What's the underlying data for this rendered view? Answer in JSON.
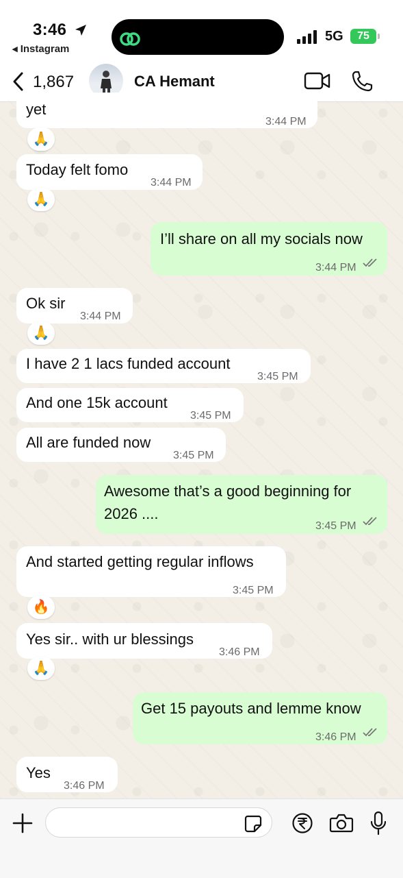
{
  "status_bar": {
    "time": "3:46",
    "back_app": "◂ Instagram",
    "network": "5G",
    "battery": "75"
  },
  "header": {
    "back_count": "1,867",
    "contact_name": "CA Hemant"
  },
  "messages": [
    {
      "dir": "in",
      "text": "yet",
      "time": "3:44 PM",
      "reaction": "🙏"
    },
    {
      "dir": "in",
      "text": "Today felt fomo",
      "time": "3:44 PM",
      "reaction": "🙏"
    },
    {
      "dir": "out",
      "text": "I’ll share on all my socials now",
      "time": "3:44 PM"
    },
    {
      "dir": "in",
      "text": "Ok sir",
      "time": "3:44 PM",
      "reaction": "🙏"
    },
    {
      "dir": "in",
      "text": "I have 2 1 lacs funded account",
      "time": "3:45 PM"
    },
    {
      "dir": "in",
      "text": "And one 15k account",
      "time": "3:45 PM"
    },
    {
      "dir": "in",
      "text": "All are funded now",
      "time": "3:45 PM"
    },
    {
      "dir": "out",
      "text_line1": "Awesome that’s a good beginning for",
      "text_line2": "2026 ....",
      "time": "3:45 PM"
    },
    {
      "dir": "in",
      "text": "And started getting regular inflows",
      "time": "3:45 PM",
      "reaction": "🔥"
    },
    {
      "dir": "in",
      "text": "Yes sir.. with ur blessings",
      "time": "3:46 PM",
      "reaction": "🙏"
    },
    {
      "dir": "out",
      "text": "Get 15 payouts and lemme know",
      "time": "3:46 PM"
    },
    {
      "dir": "in",
      "text": "Yes",
      "time": "3:46 PM"
    }
  ],
  "composer": {
    "placeholder": ""
  },
  "icons": {
    "back": "chevron-left-icon",
    "video": "video-camera-icon",
    "call": "phone-icon",
    "plus": "plus-icon",
    "sticker": "sticker-icon",
    "rupee": "rupee-payment-icon",
    "camera": "camera-icon",
    "mic": "microphone-icon"
  },
  "colors": {
    "incoming_bubble": "#ffffff",
    "outgoing_bubble": "#d9fdd3",
    "battery": "#34c759",
    "wallpaper": "#f3efe7"
  }
}
